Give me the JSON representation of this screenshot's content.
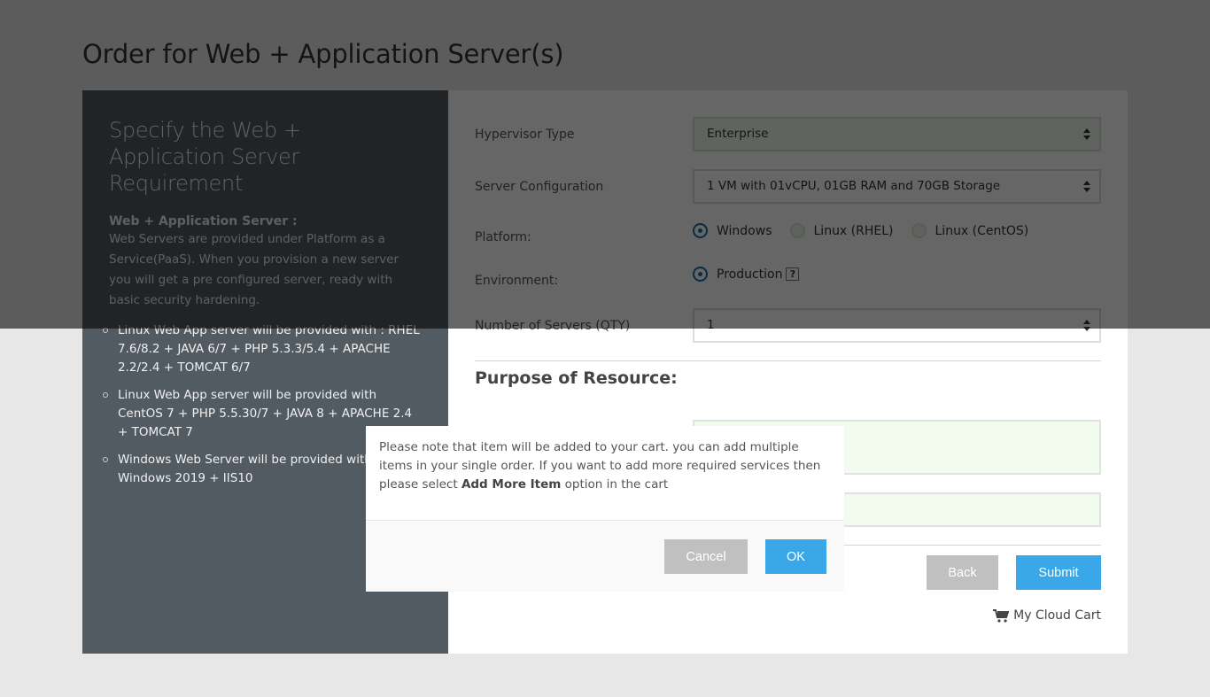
{
  "page": {
    "title": "Order for Web + Application Server(s)"
  },
  "sidebar": {
    "heading": "Specify the Web + Application Server Requirement",
    "subheading": "Web + Application Server :",
    "description": "Web Servers are provided under Platform as a Service(PaaS). When you provision a new server you will get a pre configured server, ready with basic security hardening.",
    "items": [
      {
        "text": "Linux Web App server will be provided with : RHEL 7.6/8.2 + JAVA 6/7 + PHP 5.3.3/5.4 + APACHE 2.2/2.4 + TOMCAT 6/7"
      },
      {
        "text": "Linux Web App server will be provided with CentOS 7 + PHP 5.5.30/7 + JAVA 8 + APACHE 2.4 + TOMCAT 7"
      },
      {
        "text": "Windows Web Server will be provided with Windows 2019 + IIS10"
      }
    ]
  },
  "form": {
    "hypervisor": {
      "label": "Hypervisor Type",
      "value": "Enterprise"
    },
    "server_config": {
      "label": "Server Configuration",
      "value": "1 VM with 01vCPU, 01GB RAM and 70GB Storage"
    },
    "platform": {
      "label": "Platform:",
      "options": [
        {
          "label": "Windows",
          "selected": true
        },
        {
          "label": "Linux (RHEL)",
          "selected": false
        },
        {
          "label": "Linux (CentOS)",
          "selected": false
        }
      ]
    },
    "environment": {
      "label": "Environment:",
      "options": [
        {
          "label": "Production",
          "selected": true
        }
      ],
      "help": "?"
    },
    "quantity": {
      "label": "Number of Servers (QTY)",
      "value": "1"
    },
    "purpose": {
      "title": "Purpose of Resource:"
    },
    "back_label": "Back",
    "submit_label": "Submit",
    "cart_label": "My Cloud Cart"
  },
  "modal": {
    "message_pre": "Please note that item will be added to your cart. you can add multiple items in your single order. If you want to add more required services then please select ",
    "message_bold": "Add More Item",
    "message_post": " option in the cart",
    "cancel_label": "Cancel",
    "ok_label": "OK"
  },
  "colors": {
    "primary": "#3aa8e8",
    "secondary": "#c0c0c0",
    "sidebar_bg": "#525a62",
    "radio_selected": "#1b6fa8"
  }
}
